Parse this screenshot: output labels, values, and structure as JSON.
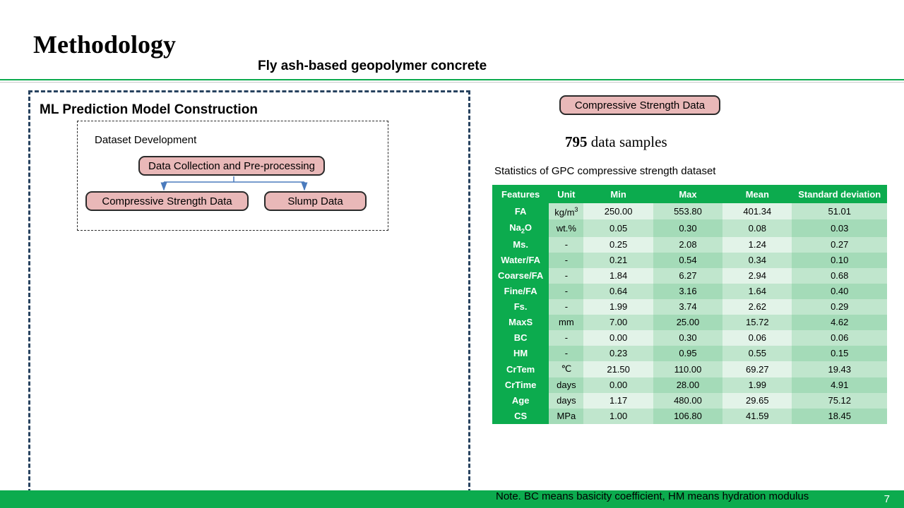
{
  "title": "Methodology",
  "subtitle": "Fly ash-based geopolymer concrete",
  "section_title": "ML Prediction Model Construction",
  "dataset_dev": "Dataset Development",
  "box1": "Data Collection and Pre-processing",
  "box2": "Compressive Strength Data",
  "box3": "Slump Data",
  "box4": "Compressive Strength Data",
  "samples_count": "795",
  "samples_suffix": " data samples",
  "table_title": "Statistics of GPC compressive strength dataset",
  "headers": {
    "f": "Features",
    "u": "Unit",
    "min": "Min",
    "max": "Max",
    "mean": "Mean",
    "sd": "Standard deviation"
  },
  "rows": [
    {
      "f": "FA",
      "u": "kg/m",
      "u_sup": "3",
      "min": "250.00",
      "max": "553.80",
      "mean": "401.34",
      "sd": "51.01"
    },
    {
      "f": "Na",
      "f_sub": "2",
      "f_suf": "O",
      "u": "wt.%",
      "min": "0.05",
      "max": "0.30",
      "mean": "0.08",
      "sd": "0.03"
    },
    {
      "f": "Ms.",
      "u": "-",
      "min": "0.25",
      "max": "2.08",
      "mean": "1.24",
      "sd": "0.27"
    },
    {
      "f": "Water/FA",
      "u": "-",
      "min": "0.21",
      "max": "0.54",
      "mean": "0.34",
      "sd": "0.10"
    },
    {
      "f": "Coarse/FA",
      "u": "-",
      "min": "1.84",
      "max": "6.27",
      "mean": "2.94",
      "sd": "0.68"
    },
    {
      "f": "Fine/FA",
      "u": "-",
      "min": "0.64",
      "max": "3.16",
      "mean": "1.64",
      "sd": "0.40"
    },
    {
      "f": "Fs.",
      "u": "-",
      "min": "1.99",
      "max": "3.74",
      "mean": "2.62",
      "sd": "0.29"
    },
    {
      "f": "MaxS",
      "u": "mm",
      "min": "7.00",
      "max": "25.00",
      "mean": "15.72",
      "sd": "4.62"
    },
    {
      "f": "BC",
      "u": "-",
      "min": "0.00",
      "max": "0.30",
      "mean": "0.06",
      "sd": "0.06"
    },
    {
      "f": "HM",
      "u": "-",
      "min": "0.23",
      "max": "0.95",
      "mean": "0.55",
      "sd": "0.15"
    },
    {
      "f": "CrTem",
      "u": "℃",
      "min": "21.50",
      "max": "110.00",
      "mean": "69.27",
      "sd": "19.43"
    },
    {
      "f": "CrTime",
      "u": "days",
      "min": "0.00",
      "max": "28.00",
      "mean": "1.99",
      "sd": "4.91"
    },
    {
      "f": "Age",
      "u": "days",
      "min": "1.17",
      "max": "480.00",
      "mean": "29.65",
      "sd": "75.12"
    },
    {
      "f": "CS",
      "u": "MPa",
      "min": "1.00",
      "max": "106.80",
      "mean": "41.59",
      "sd": "18.45"
    }
  ],
  "note": "Note. BC means basicity coefficient, HM means hydration modulus",
  "page_num": "7"
}
